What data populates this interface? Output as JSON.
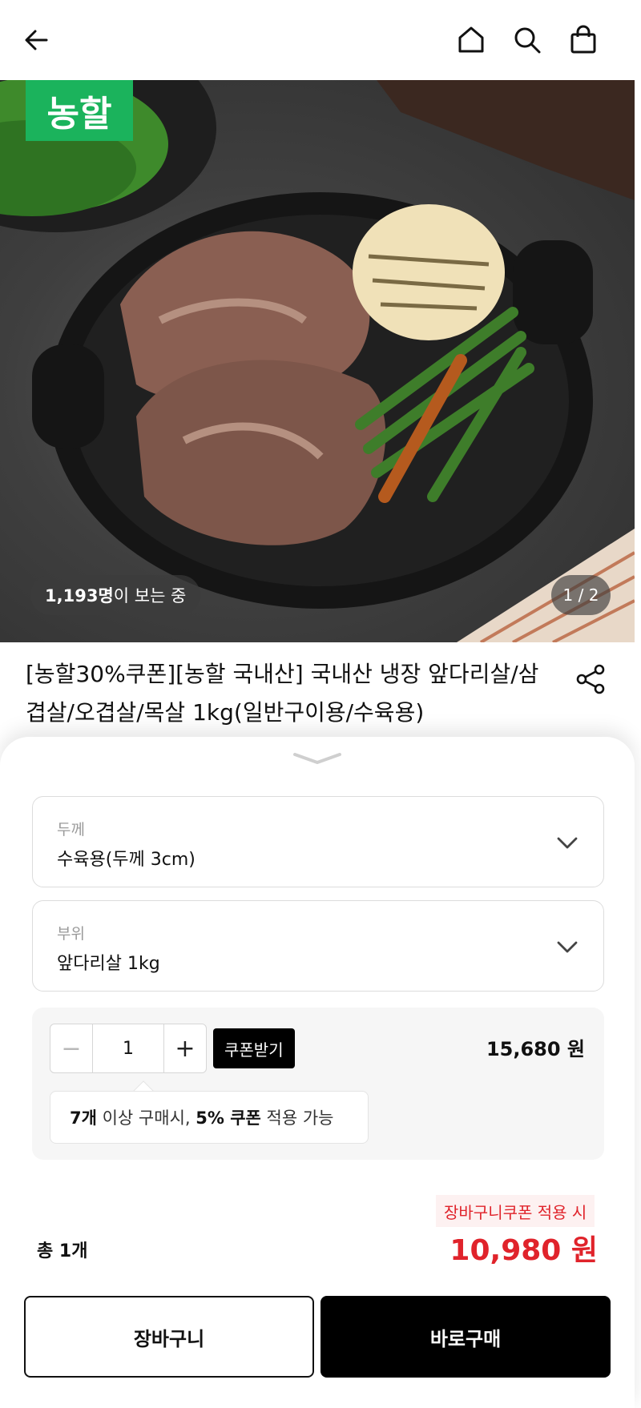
{
  "header": {
    "back_icon": "arrow-left-icon",
    "home_icon": "home-icon",
    "search_icon": "search-icon",
    "cart_icon": "shopping-bag-icon"
  },
  "hero": {
    "logo_text": "농할",
    "viewers_count": "1,193명",
    "viewers_suffix": "이 보는 중",
    "pager_text": "1 / 2"
  },
  "product": {
    "title": "[농할30%쿠폰][농할 국내산] 국내산 냉장 앞다리살/삼겹살/오겹살/목살 1kg(일반구이용/수육용)",
    "share_icon": "share-icon"
  },
  "options": [
    {
      "label": "두께",
      "value": "수육용(두께 3cm)"
    },
    {
      "label": "부위",
      "value": "앞다리살 1kg"
    }
  ],
  "quantity": {
    "minus": "−",
    "value": "1",
    "plus": "+",
    "coupon_button": "쿠폰받기",
    "price": "15,680 원",
    "tooltip_count": "7개",
    "tooltip_mid": " 이상 구매시, ",
    "tooltip_rate": "5% 쿠폰",
    "tooltip_end": " 적용 가능"
  },
  "summary": {
    "discount_tag": "장바구니쿠폰 적용 시",
    "total_label": "총 1개",
    "total_price": "10,980 원"
  },
  "actions": {
    "cart_label": "장바구니",
    "buy_label": "바로구매"
  },
  "colors": {
    "accent_red": "#e0232b",
    "brand_green": "#1bb35c",
    "primary_black": "#000000"
  }
}
